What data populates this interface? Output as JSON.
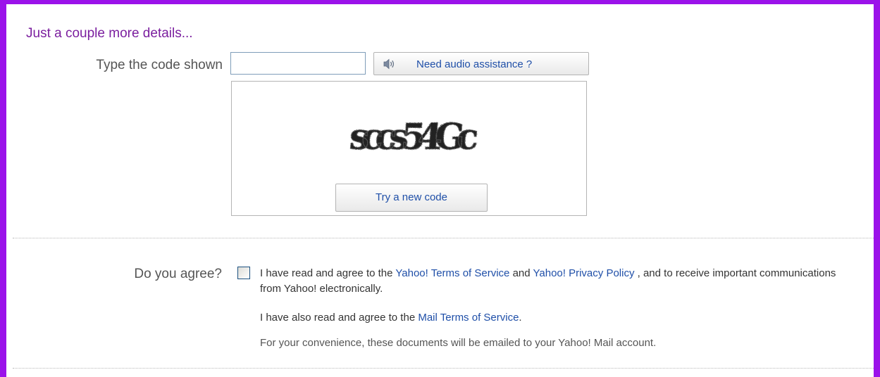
{
  "section": {
    "heading": "Just a couple more details..."
  },
  "captcha": {
    "label": "Type the code shown",
    "input_value": "",
    "input_placeholder": "",
    "audio_button_label": "Need audio assistance ?",
    "image_text": "sccs54Gc",
    "new_code_button_label": "Try a new code"
  },
  "agreement": {
    "label": "Do you agree?",
    "checked": false,
    "text_1": "I have read and agree to the ",
    "link_tos": "Yahoo! Terms of Service",
    "text_2": " and ",
    "link_privacy": "Yahoo! Privacy Policy",
    "text_3": " , and to receive important communications from Yahoo! electronically.",
    "mail_text": "I have also read and agree to the ",
    "link_mail_tos": "Mail Terms of Service",
    "mail_text_end": ".",
    "convenience_text": "For your convenience, these documents will be emailed to your Yahoo! Mail account."
  },
  "colors": {
    "frame": "#9b12ea",
    "heading": "#7b1f9f",
    "link": "#1f4fa8"
  },
  "icons": {
    "audio": "speaker-icon"
  }
}
